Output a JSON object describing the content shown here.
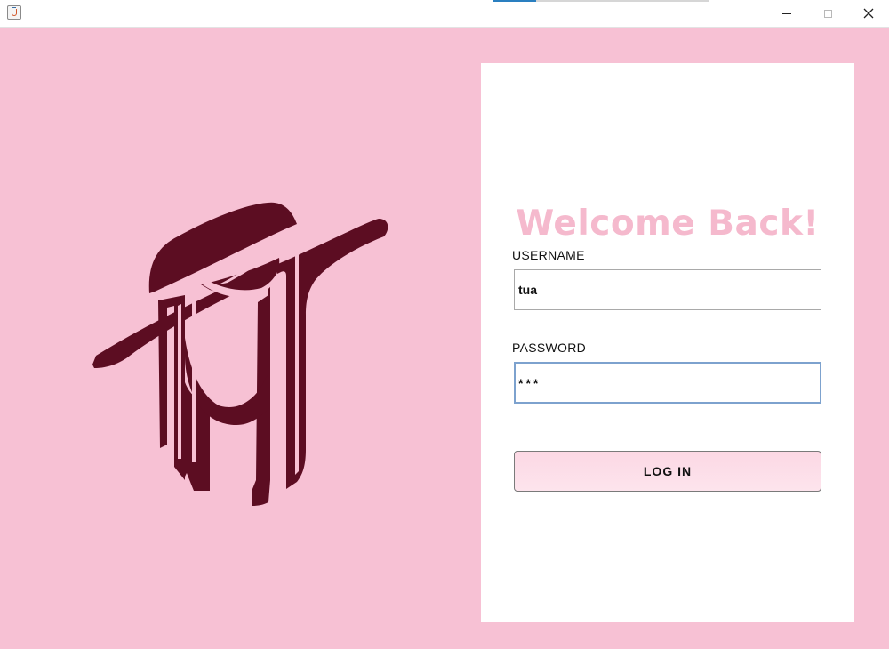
{
  "window": {
    "title": "",
    "controls": [
      "minimize-icon",
      "maximize-icon",
      "close-icon"
    ]
  },
  "colors": {
    "background": "#f7c1d4",
    "card": "#ffffff",
    "title_pink": "#f5b9cd",
    "logo": "#5c0d22",
    "button": "#fcd8e4"
  },
  "login": {
    "heading": "Welcome Back!",
    "username_label": "USERNAME",
    "username_value": "tua",
    "password_label": "PASSWORD",
    "password_value": "***",
    "login_button": "LOG IN"
  },
  "illustration": {
    "icon": "woman-with-hat-logo"
  }
}
